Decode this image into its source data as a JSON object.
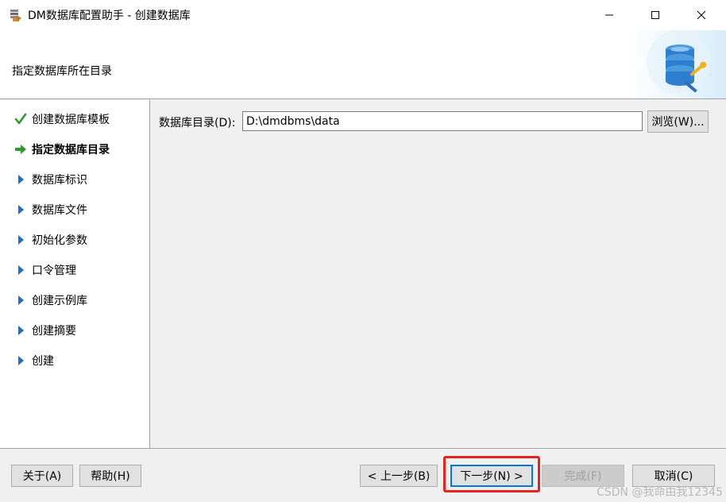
{
  "window": {
    "title": "DM数据库配置助手 - 创建数据库",
    "icon": "dm-installer-icon",
    "controls": {
      "minimize": "minimize-icon",
      "maximize": "maximize-icon",
      "close": "close-icon"
    }
  },
  "header": {
    "subtitle": "指定数据库所在目录",
    "banner_icon": "database-tools-icon"
  },
  "steps": [
    {
      "label": "创建数据库模板",
      "status": "done",
      "icon": "check-icon"
    },
    {
      "label": "指定数据库目录",
      "status": "current",
      "icon": "arrow-right-icon"
    },
    {
      "label": "数据库标识",
      "status": "pending",
      "icon": "triangle-right-icon"
    },
    {
      "label": "数据库文件",
      "status": "pending",
      "icon": "triangle-right-icon"
    },
    {
      "label": "初始化参数",
      "status": "pending",
      "icon": "triangle-right-icon"
    },
    {
      "label": "口令管理",
      "status": "pending",
      "icon": "triangle-right-icon"
    },
    {
      "label": "创建示例库",
      "status": "pending",
      "icon": "triangle-right-icon"
    },
    {
      "label": "创建摘要",
      "status": "pending",
      "icon": "triangle-right-icon"
    },
    {
      "label": "创建",
      "status": "pending",
      "icon": "triangle-right-icon"
    }
  ],
  "form": {
    "dir_label": "数据库目录(D):",
    "dir_value": "D:\\dmdbms\\data",
    "browse_label": "浏览(W)..."
  },
  "footer": {
    "about": "关于(A)",
    "help": "帮助(H)",
    "prev": "< 上一步(B)",
    "next": "下一步(N) >",
    "finish": "完成(F)",
    "cancel": "取消(C)"
  },
  "watermark": "CSDN @我命由我12345",
  "colors": {
    "check": "#2e9a2e",
    "current_arrow": "#2e9a2e",
    "pending_triangle": "#1f6fc5",
    "highlight": "#e8231f",
    "focus_border": "#0078d7"
  }
}
